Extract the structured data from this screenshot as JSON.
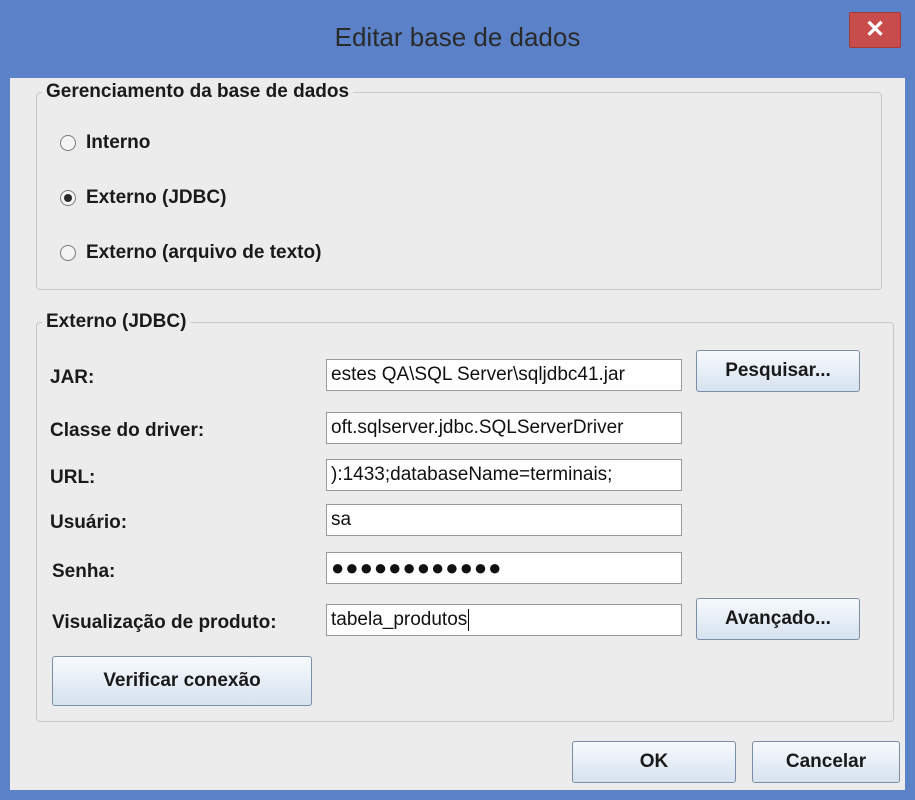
{
  "window": {
    "title": "Editar base de dados",
    "close_glyph": "✕"
  },
  "db_management": {
    "legend": "Gerenciamento da base de dados",
    "options": [
      {
        "label": "Interno",
        "selected": false
      },
      {
        "label": "Externo (JDBC)",
        "selected": true
      },
      {
        "label": "Externo (arquivo de texto)",
        "selected": false
      }
    ]
  },
  "jdbc": {
    "legend": "Externo (JDBC)",
    "jar_label": "JAR:",
    "jar_value": "estes QA\\SQL Server\\sqljdbc41.jar",
    "browse_button": "Pesquisar...",
    "driver_label": "Classe do driver:",
    "driver_value": "oft.sqlserver.jdbc.SQLServerDriver",
    "url_label": "URL:",
    "url_value": "):1433;databaseName=terminais;",
    "user_label": "Usuário:",
    "user_value": "sa",
    "password_label": "Senha:",
    "password_value": "●●●●●●●●●●●●",
    "product_view_label": "Visualização de produto:",
    "product_view_value": "tabela_produtos",
    "advanced_button": "Avançado...",
    "verify_button": "Verificar conexão"
  },
  "footer": {
    "ok_button": "OK",
    "cancel_button": "Cancelar"
  }
}
